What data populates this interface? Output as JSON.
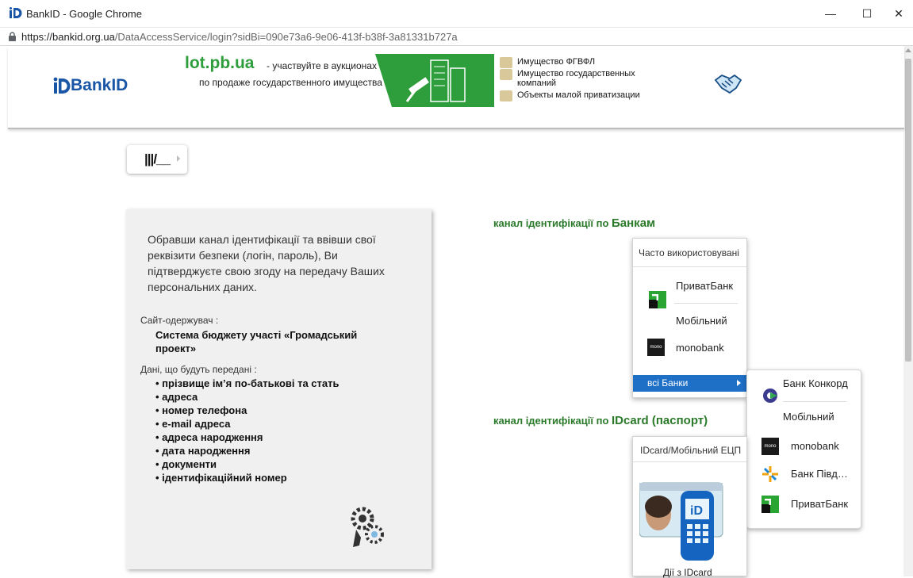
{
  "window": {
    "title": "BankID - Google Chrome",
    "minimize": "—",
    "maximize": "☐",
    "close": "✕"
  },
  "address": {
    "host": "https://bankid.org.ua",
    "path": "/DataAccessService/login?sidBi=090e73a6-9e06-413f-b38f-3a81331b727a"
  },
  "header": {
    "logo_text": "BankID",
    "ad": {
      "lot": "lot.pb.ua",
      "tagline1": "- участвуйте в аукционах",
      "tagline2": "по продаже государственного имущества",
      "links": [
        "Имущество ФГВФЛ",
        "Имущество государственных компаний",
        "Объекты малой приватизации"
      ]
    }
  },
  "panel": {
    "intro": "Обравши канал ідентифікації та ввівши свої реквізити безпеки (логін, пароль), Ви підтверджуєте свою згоду на передачу Ваших персональних даних.",
    "recipient_label": "Сайт-одержувач :",
    "recipient": "Система бюджету участі «Громадський проект»",
    "data_label": "Дані, що будуть передані :",
    "data_items": [
      "прізвище ім’я по-батькові та стать",
      "адреса",
      "номер телефона",
      "e-mail адреса",
      "адреса народження",
      "дата народження",
      "документи",
      "ідентифікаційний номер"
    ]
  },
  "banks": {
    "heading_prefix": "канал ідентифікації по ",
    "heading_word": "Банкам",
    "frequent_header": "Часто використовувані",
    "privat_label": "ПриватБанк",
    "privat_mobile": "Мобільний",
    "mono_label": "monobank",
    "all_banks": "всі Банки"
  },
  "submenu": {
    "concord": "Банк Конкорд",
    "concord_mobile": "Мобільний",
    "mono": "monobank",
    "pivden": "Банк Півд…",
    "privat": "ПриватБанк"
  },
  "idcard": {
    "heading_prefix": "канал ідентифікації по ",
    "heading_word": "IDcard (паспорт)",
    "header": "IDcard/Мобільний ЕЦП",
    "caption": "Дії з IDcard"
  }
}
